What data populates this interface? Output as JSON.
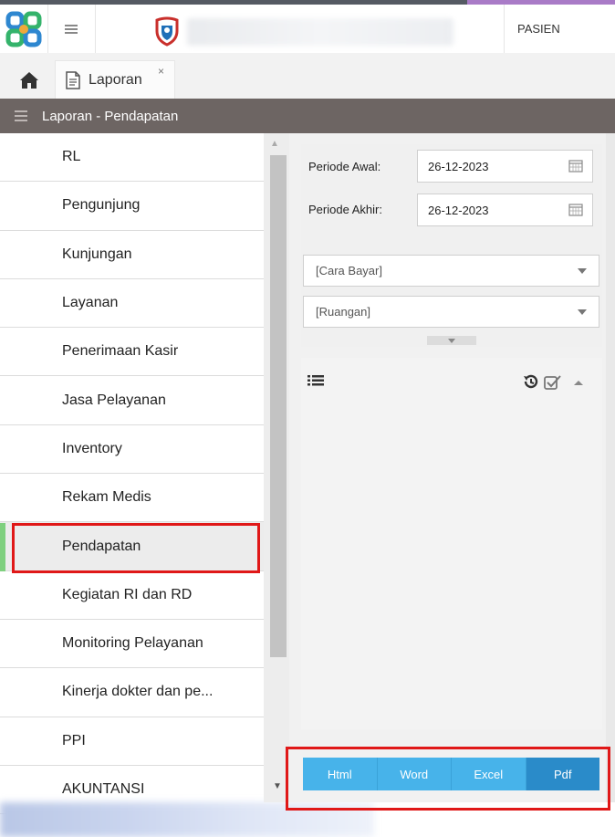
{
  "header": {
    "app_logo_icon": "tricolor-knot-logo-icon",
    "menu_icon": "hamburger-icon",
    "hospital_logo_icon": "hospital-shield-logo-icon",
    "user_menu_label": "PASIEN"
  },
  "tabs": {
    "home_icon": "home-icon",
    "active_tab": {
      "icon": "document-icon",
      "label": "Laporan",
      "close_glyph": "×"
    }
  },
  "page_header": {
    "title": "Laporan - Pendapatan"
  },
  "sidebar": {
    "items": [
      {
        "label": "RL"
      },
      {
        "label": "Pengunjung"
      },
      {
        "label": "Kunjungan"
      },
      {
        "label": "Layanan"
      },
      {
        "label": "Penerimaan Kasir"
      },
      {
        "label": "Jasa Pelayanan"
      },
      {
        "label": "Inventory"
      },
      {
        "label": "Rekam Medis"
      },
      {
        "label": "Pendapatan"
      },
      {
        "label": "Kegiatan RI dan RD"
      },
      {
        "label": "Monitoring Pelayanan"
      },
      {
        "label": "Kinerja dokter dan pe..."
      },
      {
        "label": "PPI"
      },
      {
        "label": "AKUNTANSI"
      }
    ],
    "active_label": "Pendapatan"
  },
  "filters": {
    "periode_awal": {
      "label": "Periode Awal:",
      "value": "26-12-2023"
    },
    "periode_akhir": {
      "label": "Periode Akhir:",
      "value": "26-12-2023"
    },
    "cara_bayar": {
      "value": "[Cara Bayar]"
    },
    "ruangan": {
      "value": "[Ruangan]"
    }
  },
  "report_toolbar": {
    "list_icon": "list-icon",
    "reset_icon": "history-icon",
    "check_icon": "checkbox-check-icon",
    "collapse_icon": "caret-up-icon"
  },
  "export": {
    "buttons": [
      {
        "label": "Html"
      },
      {
        "label": "Word"
      },
      {
        "label": "Excel"
      },
      {
        "label": "Pdf"
      }
    ],
    "selected": "Pdf"
  },
  "colors": {
    "page_header_bg": "#6d6563",
    "export_btn": "#47b3ea",
    "export_btn_selected": "#2a8bc9",
    "highlight_box": "#e01818",
    "active_indicator": "#7fd07f"
  }
}
